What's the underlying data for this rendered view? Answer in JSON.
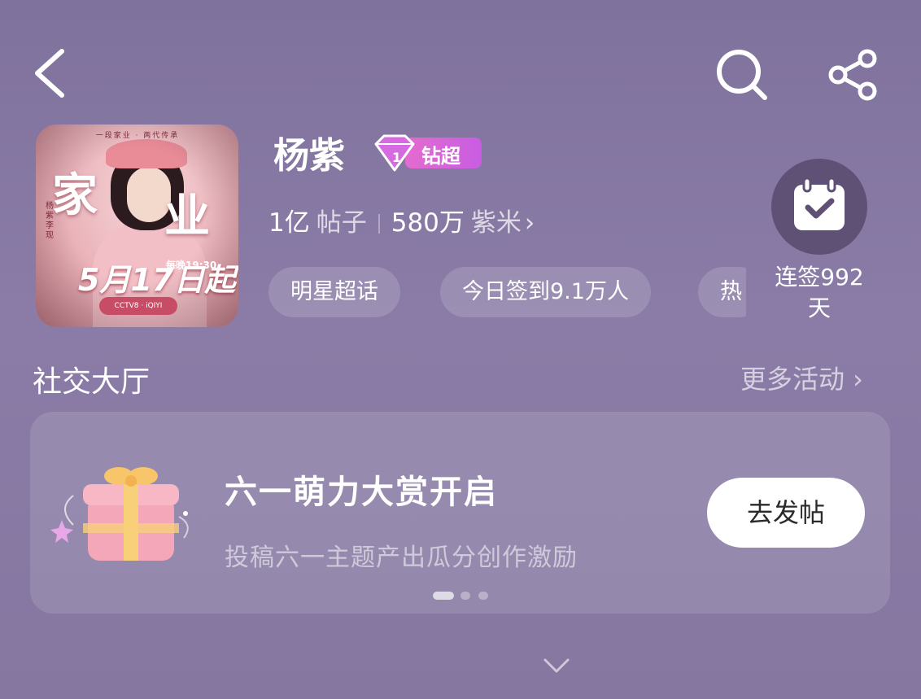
{
  "header": {
    "back_icon": "chevron-left-icon",
    "search_icon": "search-icon",
    "share_icon": "share-icon"
  },
  "poster": {
    "headline": "一段家业 · 两代传承",
    "title_char1": "家",
    "title_char2": "业",
    "cast": "杨紫 李现",
    "date": "5月17日起",
    "time": "每晚19:30",
    "channels": "CCTV8 · iQIYI"
  },
  "profile": {
    "name": "杨紫",
    "badge_label": "钻超",
    "badge_level": "1",
    "posts_count": "1亿",
    "posts_unit": "帖子",
    "fans_count": "580万",
    "fans_unit": "紫米",
    "fans_chevron": "›"
  },
  "tags": [
    {
      "label": "明星超话"
    },
    {
      "label": "今日签到9.1万人"
    },
    {
      "label": "热"
    }
  ],
  "signin": {
    "icon": "calendar-check-icon",
    "line1": "连签992",
    "line2": "天"
  },
  "social": {
    "title": "社交大厅",
    "more_label": "更多活动 ›"
  },
  "banner": {
    "icon": "gift-box-icon",
    "title": "六一萌力大赏开启",
    "subtitle": "投稿六一主题产出瓜分创作激励",
    "button_label": "去发帖",
    "page_count": 3,
    "active_page": 1
  },
  "footer": {
    "expand_icon": "chevron-down-icon"
  },
  "colors": {
    "background": "#8577a0",
    "badge_pink": "#e36ccf",
    "signin_circle": "#5f5175"
  }
}
